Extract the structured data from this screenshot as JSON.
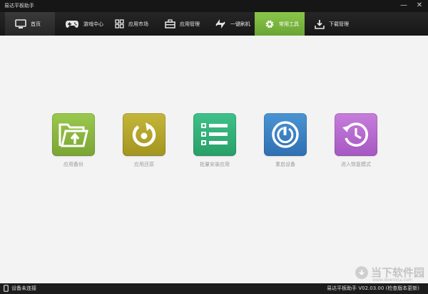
{
  "app": {
    "title": "易达平板助手"
  },
  "window_controls": {
    "minimize": "—",
    "close": "✕"
  },
  "nav": {
    "tabs": [
      {
        "label": "首页",
        "icon": "monitor-icon"
      },
      {
        "label": "游戏中心",
        "icon": "gamepad-icon"
      },
      {
        "label": "应用市场",
        "icon": "app-grid-icon"
      },
      {
        "label": "应用管理",
        "icon": "toolbox-icon"
      },
      {
        "label": "一键刷机",
        "icon": "flash-arrows-icon"
      },
      {
        "label": "常用工具",
        "icon": "gear-icon"
      },
      {
        "label": "下载管理",
        "icon": "download-icon"
      }
    ],
    "selected": "常用工具"
  },
  "tools": [
    {
      "label": "应用备份",
      "icon": "folder-upload-icon",
      "color": "#8ab53f"
    },
    {
      "label": "应用还原",
      "icon": "restore-icon",
      "color": "#b3a52e"
    },
    {
      "label": "批量安装应用",
      "icon": "list-icon",
      "color": "#33b27a"
    },
    {
      "label": "重启设备",
      "icon": "power-icon",
      "color": "#3b82c4"
    },
    {
      "label": "进入恢复模式",
      "icon": "history-clock-icon",
      "color": "#b86ad0"
    }
  ],
  "status": {
    "connection": "设备未连接",
    "version": "易达平板助手 V02.03.00 (检查版本更新)"
  },
  "watermark": {
    "text": "当下软件园",
    "url": "www.downxia.com"
  }
}
